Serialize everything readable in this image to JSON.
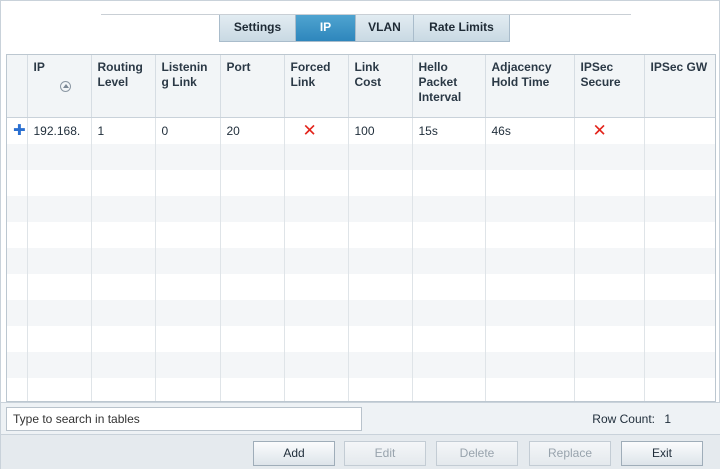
{
  "tabs": [
    {
      "label": "Settings",
      "active": false
    },
    {
      "label": "IP",
      "active": true
    },
    {
      "label": "VLAN",
      "active": false
    },
    {
      "label": "Rate Limits",
      "active": false
    }
  ],
  "table": {
    "columns": [
      "IP",
      "Routing Level",
      "Listening Link",
      "Port",
      "Forced Link",
      "Link Cost",
      "Hello Packet Interval",
      "Adjacency Hold Time",
      "IPSec Secure",
      "IPSec GW"
    ],
    "rows": [
      {
        "ip": "192.168.",
        "routing_level": "1",
        "listening_link": "0",
        "port": "20",
        "forced_link": "x",
        "link_cost": "100",
        "hello_interval": "15s",
        "hold_time": "46s",
        "ipsec_secure": "x",
        "ipsec_gw": ""
      }
    ]
  },
  "search": {
    "placeholder": "Type to search in tables",
    "value": ""
  },
  "row_count": {
    "label": "Row Count:",
    "value": "1"
  },
  "buttons": {
    "add": "Add",
    "edit": "Edit",
    "delete": "Delete",
    "replace": "Replace",
    "exit": "Exit"
  },
  "colors": {
    "active_tab": "#3a93c6",
    "false_mark": "#e3241b",
    "expand_icon": "#2a6fd0"
  }
}
